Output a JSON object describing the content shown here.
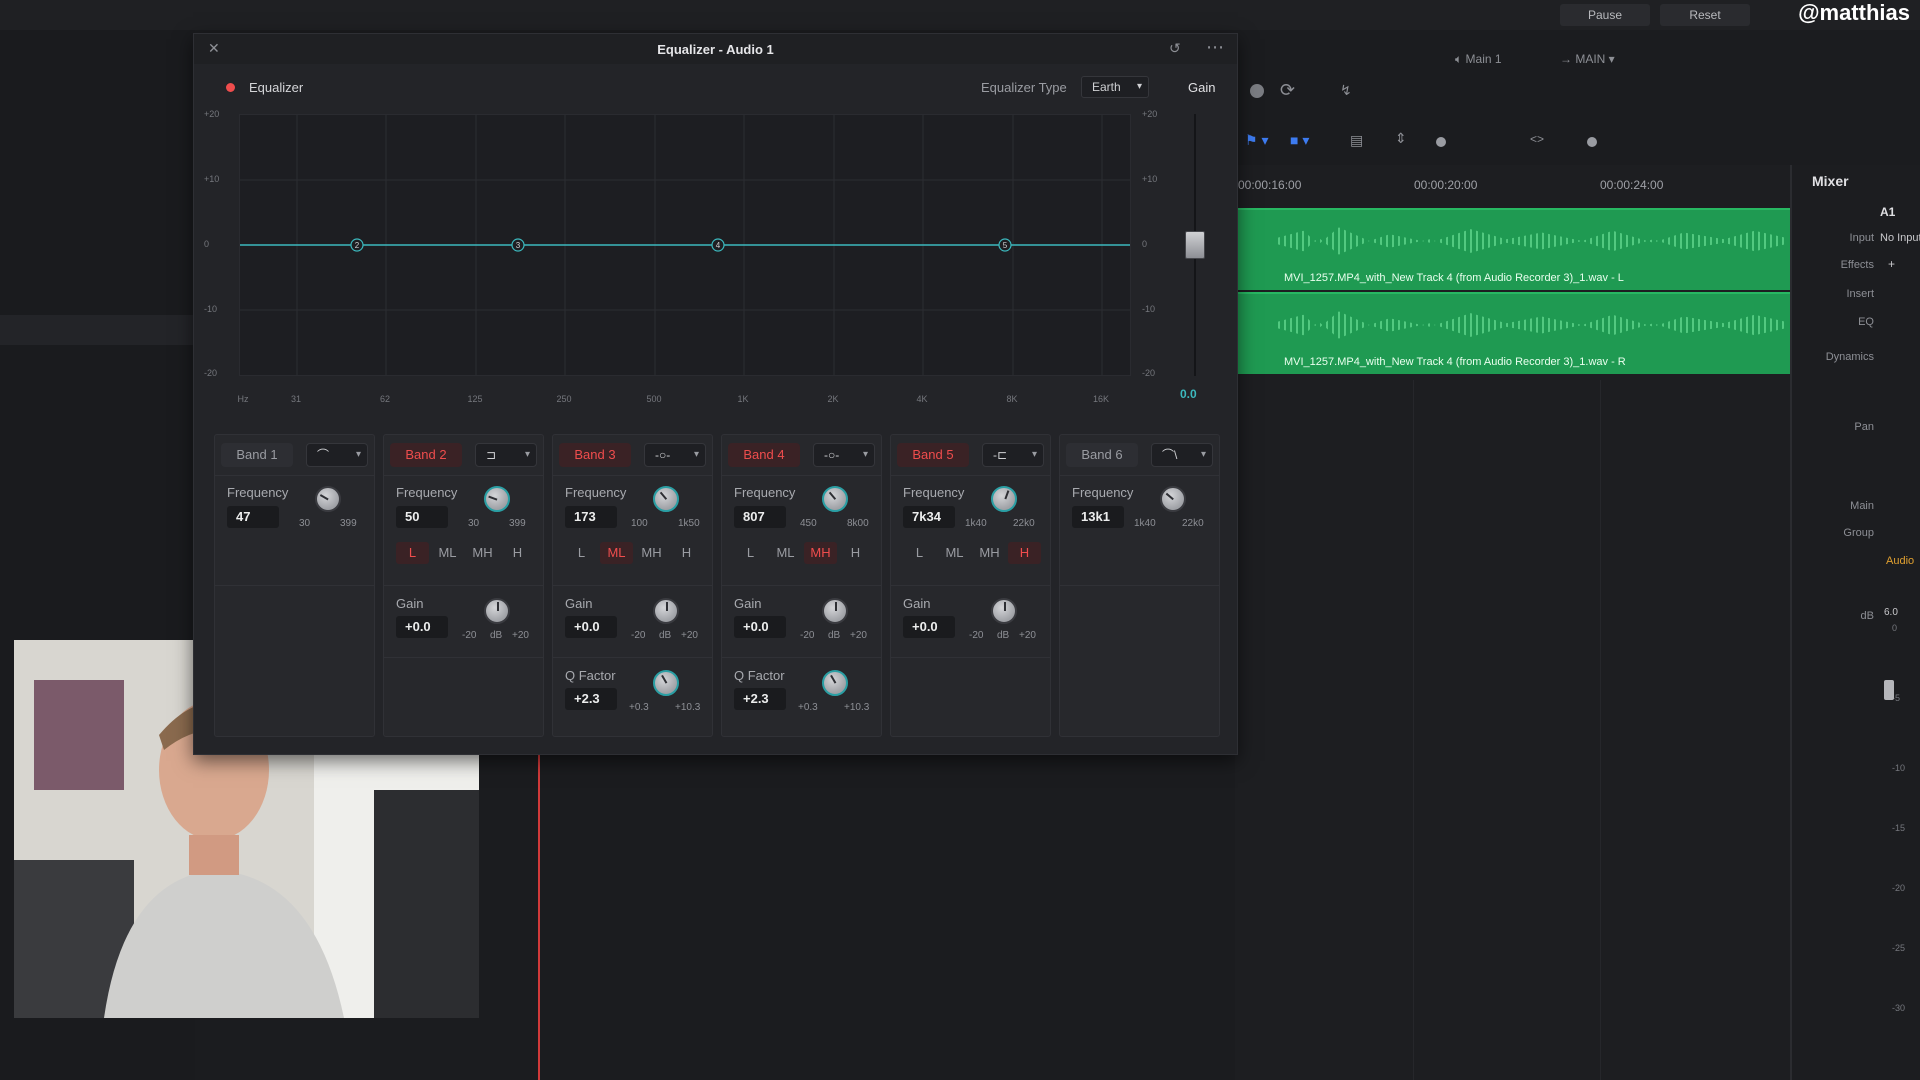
{
  "background": {
    "top_buttons": [
      "Pause",
      "Reset"
    ],
    "main_label": "Main 1",
    "main_select": "MAIN",
    "timecodes": [
      "00:00:16:00",
      "00:00:20:00",
      "00:00:24:00"
    ],
    "clips": [
      "MVI_1257.MP4_with_New Track 4 (from Audio Recorder 3)_1.wav - L",
      "MVI_1257.MP4_with_New Track 4 (from Audio Recorder 3)_1.wav - R"
    ],
    "handle": "@matthias",
    "mixer": {
      "title": "Mixer",
      "channel": "A1",
      "input_value": "No Input",
      "labels": [
        "Input",
        "Effects",
        "Insert",
        "EQ",
        "Dynamics",
        "Pan",
        "Main",
        "Group",
        "dB"
      ],
      "track_name": "Audio",
      "db_readout": "6.0",
      "db_scale": [
        "0",
        "-5",
        "-10",
        "-15",
        "-20",
        "-25",
        "-30"
      ]
    }
  },
  "eq": {
    "window_title": "Equalizer - Audio 1",
    "enable_label": "Equalizer",
    "type_label": "Equalizer Type",
    "type_value": "Earth",
    "gain_label": "Gain",
    "gain_value": "0.0",
    "db_ticks": [
      "+20",
      "+10",
      "0",
      "-10",
      "-20"
    ],
    "freq_ticks": [
      "Hz",
      "31",
      "62",
      "125",
      "250",
      "500",
      "1K",
      "2K",
      "4K",
      "8K",
      "16K"
    ],
    "nodes": [
      "2",
      "3",
      "4",
      "5"
    ],
    "accent": "#ef4d4d",
    "curve_color": "#3cb9be",
    "bands": [
      {
        "name": "Band 1",
        "active": false,
        "freq_label": "Frequency",
        "freq": "47",
        "min": "30",
        "max": "399"
      },
      {
        "name": "Band 2",
        "active": true,
        "freq_label": "Frequency",
        "freq": "50",
        "min": "30",
        "max": "399",
        "lmh": [
          "L",
          "ML",
          "MH",
          "H"
        ],
        "lmh_on": 0,
        "gain_label": "Gain",
        "gain": "+0.0",
        "gmin": "-20",
        "gunit": "dB",
        "gmax": "+20"
      },
      {
        "name": "Band 3",
        "active": true,
        "freq_label": "Frequency",
        "freq": "173",
        "min": "100",
        "max": "1k50",
        "lmh": [
          "L",
          "ML",
          "MH",
          "H"
        ],
        "lmh_on": 1,
        "gain_label": "Gain",
        "gain": "+0.0",
        "gmin": "-20",
        "gunit": "dB",
        "gmax": "+20",
        "q_label": "Q Factor",
        "q": "+2.3",
        "qmin": "+0.3",
        "qmax": "+10.3"
      },
      {
        "name": "Band 4",
        "active": true,
        "freq_label": "Frequency",
        "freq": "807",
        "min": "450",
        "max": "8k00",
        "lmh": [
          "L",
          "ML",
          "MH",
          "H"
        ],
        "lmh_on": 2,
        "gain_label": "Gain",
        "gain": "+0.0",
        "gmin": "-20",
        "gunit": "dB",
        "gmax": "+20",
        "q_label": "Q Factor",
        "q": "+2.3",
        "qmin": "+0.3",
        "qmax": "+10.3"
      },
      {
        "name": "Band 5",
        "active": true,
        "freq_label": "Frequency",
        "freq": "7k34",
        "min": "1k40",
        "max": "22k0",
        "lmh": [
          "L",
          "ML",
          "MH",
          "H"
        ],
        "lmh_on": 3,
        "gain_label": "Gain",
        "gain": "+0.0",
        "gmin": "-20",
        "gunit": "dB",
        "gmax": "+20"
      },
      {
        "name": "Band 6",
        "active": false,
        "freq_label": "Frequency",
        "freq": "13k1",
        "min": "1k40",
        "max": "22k0"
      }
    ]
  }
}
